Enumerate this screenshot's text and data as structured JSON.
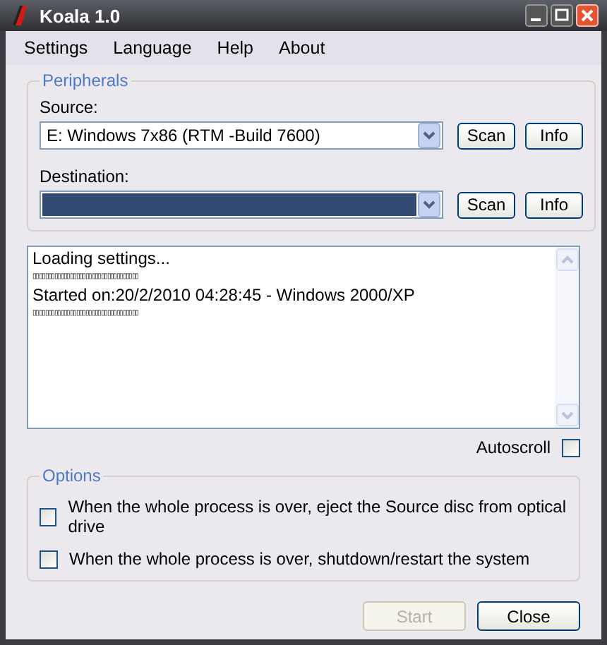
{
  "window": {
    "title": "Koala 1.0"
  },
  "menu": [
    "Settings",
    "Language",
    "Help",
    "About"
  ],
  "peripherals": {
    "legend": "Peripherals",
    "fields": [
      {
        "label": "Source:",
        "value": "E: Windows 7x86 (RTM -Build 7600)",
        "highlighted": false,
        "buttons": [
          "Scan",
          "Info"
        ]
      },
      {
        "label": "Destination:",
        "highlighted": true,
        "buttons": [
          "Scan",
          "Info"
        ]
      }
    ]
  },
  "log": {
    "lines": [
      {
        "kind": "text",
        "text": "Loading settings..."
      },
      {
        "kind": "glyphs",
        "text": "▯▯▯▯▯▯▯▯▯▯▯▯▯▯▯▯▯▯▯▯▯▯▯▯▯▯▯▯▯▯▯▯▯▯"
      },
      {
        "kind": "text",
        "text": "Started on:20/2/2010 04:28:45 - Windows 2000/XP"
      },
      {
        "kind": "glyphs",
        "text": "▯▯▯▯▯▯▯▯▯▯▯▯▯▯▯▯▯▯▯▯▯▯▯▯▯▯▯▯▯▯▯▯▯▯"
      }
    ]
  },
  "autoscroll": {
    "label": "Autoscroll",
    "checked": false
  },
  "options": {
    "legend": "Options",
    "items": [
      {
        "label": "When the whole process is over, eject the Source disc from optical drive",
        "checked": false
      },
      {
        "label": "When the whole process is over, shutdown/restart the system",
        "checked": false
      }
    ]
  },
  "buttons": [
    {
      "label": "Start",
      "disabled": true
    },
    {
      "label": "Close",
      "disabled": false
    }
  ]
}
